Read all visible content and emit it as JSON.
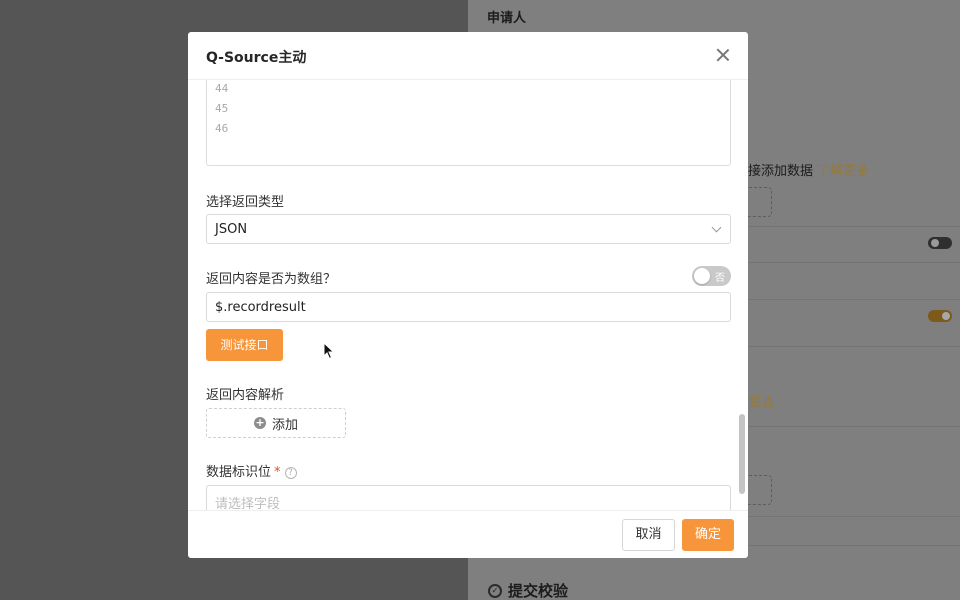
{
  "background": {
    "applicant_label": "申请人",
    "add_data_text": "接添加数据",
    "learn_more": "了解更多",
    "report_link": "报表",
    "section_title": "提交校验"
  },
  "modal": {
    "title": "Q-Source主动",
    "code_lines": [
      "44",
      "45",
      "46"
    ],
    "return_type_label": "选择返回类型",
    "return_type_value": "JSON",
    "is_array_label": "返回内容是否为数组？",
    "is_array_switch_text": "否",
    "is_array": false,
    "json_path_value": "$.recordresult",
    "test_button": "测试接口",
    "parse_label": "返回内容解析",
    "add_button": "添加",
    "identifier_label": "数据标识位",
    "identifier_required": "*",
    "identifier_help": "?",
    "identifier_placeholder": "请选择字段",
    "cancel_button": "取消",
    "confirm_button": "确定"
  },
  "colors": {
    "accent": "#f7953a",
    "required": "#e34d1c"
  },
  "icons": [
    "close-icon",
    "chevron-down-icon",
    "plus-circle-icon",
    "question-circle-icon",
    "cursor-icon",
    "check-circle-icon"
  ]
}
